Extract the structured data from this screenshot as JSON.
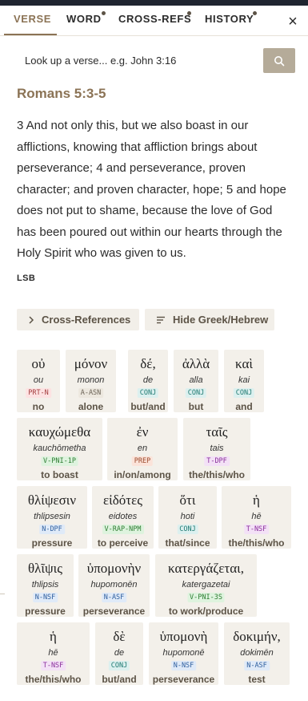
{
  "tabs": [
    {
      "label": "VERSE",
      "active": true,
      "dot": false
    },
    {
      "label": "WORD",
      "active": false,
      "dot": true
    },
    {
      "label": "CROSS-REFS",
      "active": false,
      "dot": true
    },
    {
      "label": "HISTORY",
      "active": false,
      "dot": true
    }
  ],
  "close_label": "×",
  "search": {
    "placeholder": "Look up a verse... e.g. John 3:16",
    "value": ""
  },
  "passage": {
    "reference": "Romans 5:3-5",
    "text": "3 And not only this, but we also boast in our afflictions, knowing that affliction brings about perseverance; 4 and perseverance, proven character; and proven character, hope; 5 and hope does not put to shame, because the love of God has been poured out within our hearts through the Holy Spirit who was given to us.",
    "version": "LSB"
  },
  "actions": {
    "cross_refs_label": "Cross-References",
    "hide_greek_label": "Hide Greek/Hebrew"
  },
  "tag_colors": {
    "default": {
      "bg": "#fde2e2",
      "fg": "#a23b3b"
    },
    "adjective": {
      "bg": "#ece7de",
      "fg": "#6b6256"
    },
    "conjunction": {
      "bg": "#dcf0ef",
      "fg": "#1f7a72"
    },
    "verb": {
      "bg": "#def3de",
      "fg": "#2e7d32"
    },
    "preposition": {
      "bg": "#fbe3d9",
      "fg": "#9c4a2c"
    },
    "article": {
      "bg": "#f3e1f6",
      "fg": "#8a2e9b"
    },
    "noun": {
      "bg": "#dfeaf8",
      "fg": "#2f5f9e"
    }
  },
  "words": [
    {
      "greek": "οὐ",
      "translit": "ou",
      "tag": "PRT-N",
      "kind": "default",
      "gloss": "no"
    },
    {
      "greek": "μόνον",
      "translit": "monon",
      "tag": "A-ASN",
      "kind": "adjective",
      "gloss": "alone"
    },
    {
      "greek": "δέ,",
      "translit": "de",
      "tag": "CONJ",
      "kind": "conjunction",
      "gloss": "but/and"
    },
    {
      "greek": "ἀλλὰ",
      "translit": "alla",
      "tag": "CONJ",
      "kind": "conjunction",
      "gloss": "but"
    },
    {
      "greek": "καὶ",
      "translit": "kai",
      "tag": "CONJ",
      "kind": "conjunction",
      "gloss": "and"
    },
    {
      "greek": "καυχώμεθα",
      "translit": "kauchōmetha",
      "tag": "V-PNI-1P",
      "kind": "verb",
      "gloss": "to boast"
    },
    {
      "greek": "ἐν",
      "translit": "en",
      "tag": "PREP",
      "kind": "preposition",
      "gloss": "in/on/among"
    },
    {
      "greek": "ταῖς",
      "translit": "tais",
      "tag": "T-DPF",
      "kind": "article",
      "gloss": "the/this/who"
    },
    {
      "greek": "θλίψεσιν",
      "translit": "thlipsesin",
      "tag": "N-DPF",
      "kind": "noun",
      "gloss": "pressure"
    },
    {
      "greek": "εἰδότες",
      "translit": "eidotes",
      "tag": "V-RAP-NPM",
      "kind": "verb",
      "gloss": "to perceive"
    },
    {
      "greek": "ὅτι",
      "translit": "hoti",
      "tag": "CONJ",
      "kind": "conjunction",
      "gloss": "that/since"
    },
    {
      "greek": "ἡ",
      "translit": "hē",
      "tag": "T-NSF",
      "kind": "article",
      "gloss": "the/this/who"
    },
    {
      "greek": "θλῖψις",
      "translit": "thlipsis",
      "tag": "N-NSF",
      "kind": "noun",
      "gloss": "pressure"
    },
    {
      "greek": "ὑπομονὴν",
      "translit": "hupomonēn",
      "tag": "N-ASF",
      "kind": "noun",
      "gloss": "perseverance"
    },
    {
      "greek": "κατεργάζεται,",
      "translit": "katergazetai",
      "tag": "V-PNI-3S",
      "kind": "verb",
      "gloss": "to work/produce"
    },
    {
      "greek": "ἡ",
      "translit": "hē",
      "tag": "T-NSF",
      "kind": "article",
      "gloss": "the/this/who"
    },
    {
      "greek": "δὲ",
      "translit": "de",
      "tag": "CONJ",
      "kind": "conjunction",
      "gloss": "but/and"
    },
    {
      "greek": "ὑπομονὴ",
      "translit": "hupomonē",
      "tag": "N-NSF",
      "kind": "noun",
      "gloss": "perseverance"
    },
    {
      "greek": "δοκιμήν,",
      "translit": "dokimēn",
      "tag": "N-ASF",
      "kind": "noun",
      "gloss": "test"
    }
  ]
}
